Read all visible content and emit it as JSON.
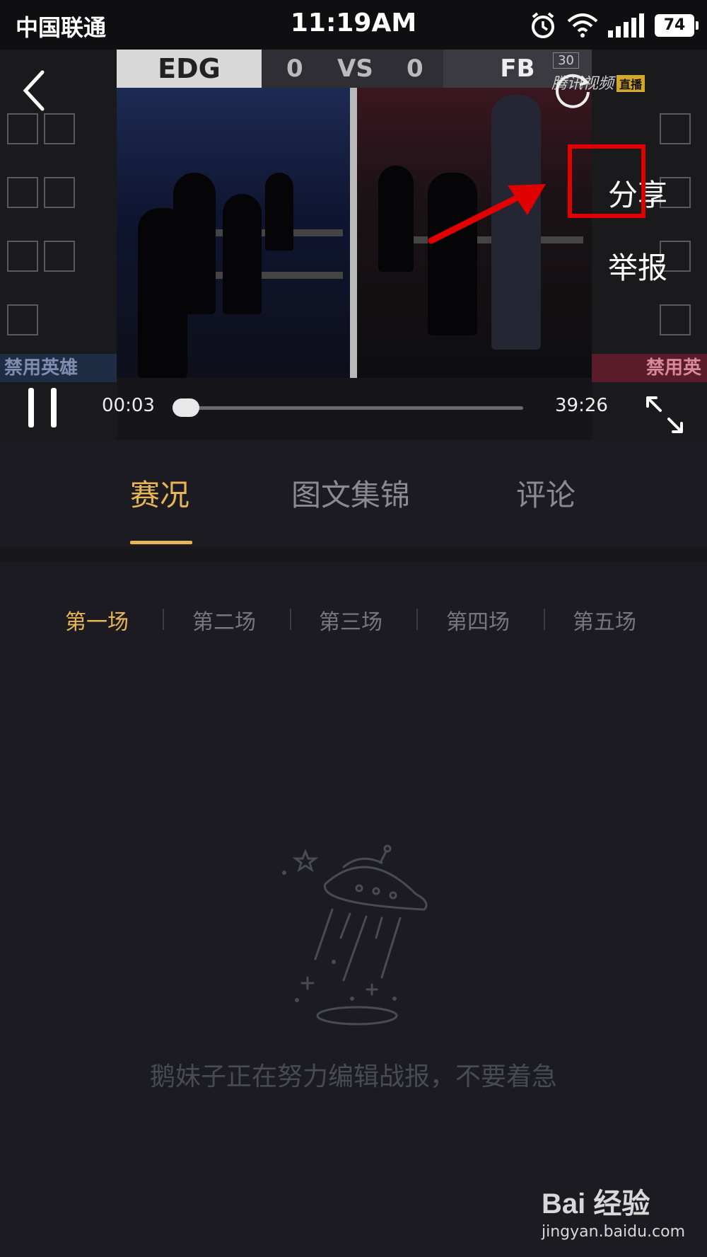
{
  "status_bar": {
    "carrier": "中国联通",
    "time": "11:19AM",
    "battery": "74"
  },
  "video": {
    "team_left": "EDG",
    "score_left": "0",
    "vs": "VS",
    "score_right": "0",
    "team_right": "FB",
    "timer_badge": "30",
    "ban_left": "禁用英雄",
    "ban_right": "禁用英",
    "watermark": "腾讯视频",
    "watermark_badge": "直播",
    "current_time": "00:03",
    "total_time": "39:26",
    "progress": 0.001
  },
  "menu": {
    "share": "分享",
    "report": "举报"
  },
  "tabs": [
    "赛况",
    "图文集锦",
    "评论"
  ],
  "active_tab": 0,
  "games": [
    "第一场",
    "第二场",
    "第三场",
    "第四场",
    "第五场"
  ],
  "active_game": 0,
  "empty_message": "鹅妹子正在努力编辑战报，不要着急",
  "page_watermark": {
    "logo": "Bai 经验",
    "url": "jingyan.baidu.com"
  },
  "colors": {
    "accent": "#e8b556",
    "highlight": "#e00000",
    "background": "#1b1b21"
  }
}
